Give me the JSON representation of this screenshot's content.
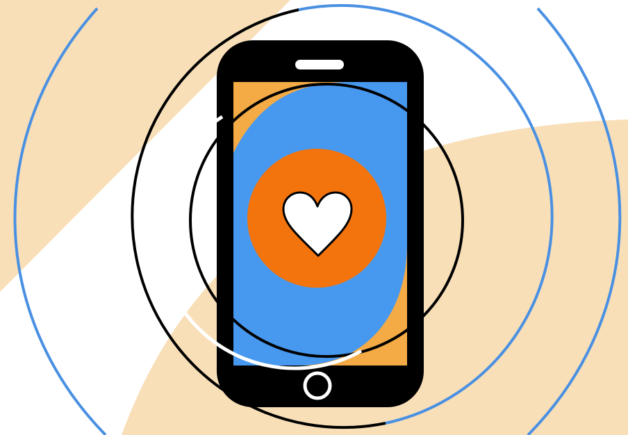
{
  "illustration": {
    "subject": "smartphone-heart-icon",
    "colors": {
      "background": "#ffffff",
      "peach": "#f8dfb8",
      "wave_blue": "#4a90e2",
      "outline": "#000000",
      "phone_body": "#000000",
      "screen_orange": "#f4ab45",
      "screen_blue": "#4798ef",
      "heart_circle": "#f3740d",
      "heart": "#ffffff",
      "ring_white": "#ffffff"
    },
    "icons": {
      "phone": "smartphone-icon",
      "heart": "heart-icon",
      "home_button": "home-button-icon",
      "speaker": "speaker-slot-icon",
      "signal": "signal-wave-icon"
    }
  }
}
